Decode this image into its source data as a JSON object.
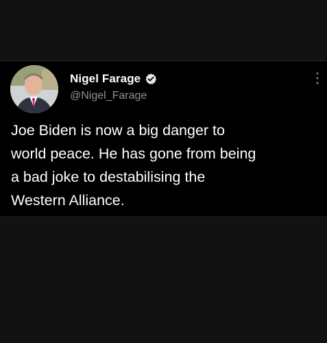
{
  "tweet": {
    "author": {
      "display_name": "Nigel Farage",
      "handle": "@Nigel_Farage",
      "verified": true,
      "avatar_icon": "profile-photo"
    },
    "text_lines": [
      "Joe Biden is now a big danger to",
      "world peace. He has gone from being",
      "a bad joke to destabilising the",
      "Western Alliance."
    ],
    "menu_icon": "more-vertical-icon"
  },
  "colors": {
    "background": "#121212",
    "card_background": "#000000",
    "text_primary": "#ffffff",
    "text_secondary": "#8b949e",
    "verified_badge": "#e6e6e6"
  }
}
